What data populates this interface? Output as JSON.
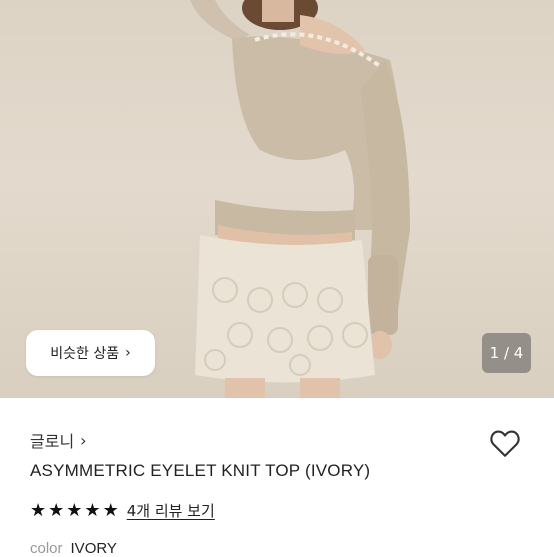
{
  "product_image": {
    "similar_button_label": "비슷한 상품",
    "similar_button_icon": "chevron-right-icon",
    "image_counter": "1 / 4"
  },
  "brand": {
    "name": "글로니",
    "icon": "chevron-right-icon"
  },
  "wishlist": {
    "icon": "heart-outline-icon"
  },
  "product": {
    "title": "ASYMMETRIC EYELET KNIT TOP (IVORY)",
    "rating_stars": 5,
    "reviews_link": "4개 리뷰 보기"
  },
  "color": {
    "label": "color",
    "value": "IVORY"
  },
  "colors": {
    "star": "#111111",
    "background": "#ffffff"
  }
}
